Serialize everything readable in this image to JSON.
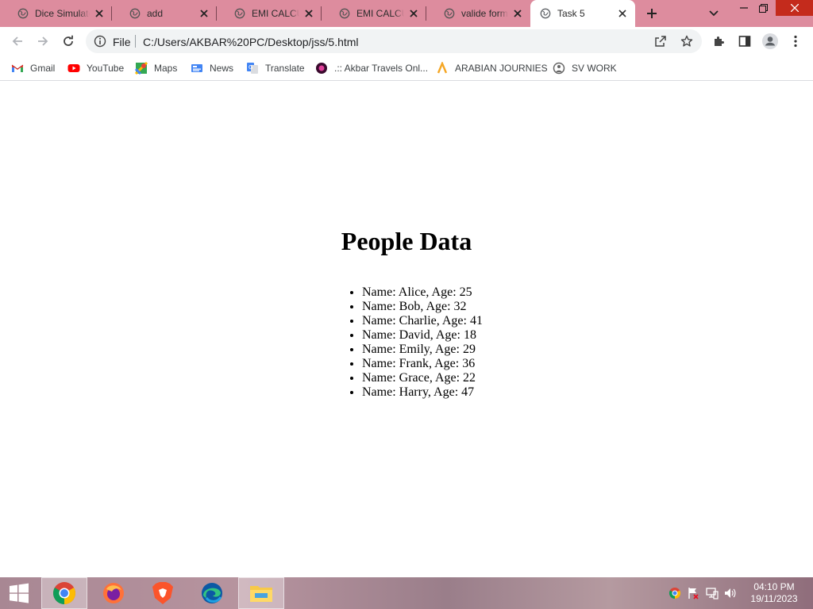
{
  "browser": {
    "tabs": [
      {
        "title": "Dice Simulator",
        "active": false
      },
      {
        "title": "add",
        "active": false
      },
      {
        "title": "EMI CALCULATOR",
        "active": false
      },
      {
        "title": "EMI CALCULATOR",
        "active": false
      },
      {
        "title": "valide form",
        "active": false
      },
      {
        "title": "Task 5",
        "active": true
      }
    ],
    "address_bar": {
      "scheme_label": "File",
      "url": "C:/Users/AKBAR%20PC/Desktop/jss/5.html"
    },
    "bookmarks": [
      {
        "label": "Gmail",
        "icon": "gmail-icon"
      },
      {
        "label": "YouTube",
        "icon": "youtube-icon"
      },
      {
        "label": "Maps",
        "icon": "maps-icon"
      },
      {
        "label": "News",
        "icon": "news-icon"
      },
      {
        "label": "Translate",
        "icon": "translate-icon"
      },
      {
        "label": ".:: Akbar Travels Onl...",
        "icon": "akbar-travels-icon"
      },
      {
        "label": "ARABIAN JOURNIES",
        "icon": "arabian-journies-icon"
      },
      {
        "label": "SV WORK",
        "icon": "sv-work-icon"
      }
    ]
  },
  "page": {
    "heading": "People Data",
    "people": [
      "Name: Alice, Age: 25",
      "Name: Bob, Age: 32",
      "Name: Charlie, Age: 41",
      "Name: David, Age: 18",
      "Name: Emily, Age: 29",
      "Name: Frank, Age: 36",
      "Name: Grace, Age: 22",
      "Name: Harry, Age: 47"
    ]
  },
  "taskbar": {
    "apps": [
      "chrome",
      "firefox",
      "brave",
      "edge",
      "file-explorer"
    ],
    "clock": {
      "time": "04:10 PM",
      "date": "19/11/2023"
    }
  },
  "colors": {
    "tabstrip": "#dd8c9e",
    "close_button": "#c42b1c"
  }
}
